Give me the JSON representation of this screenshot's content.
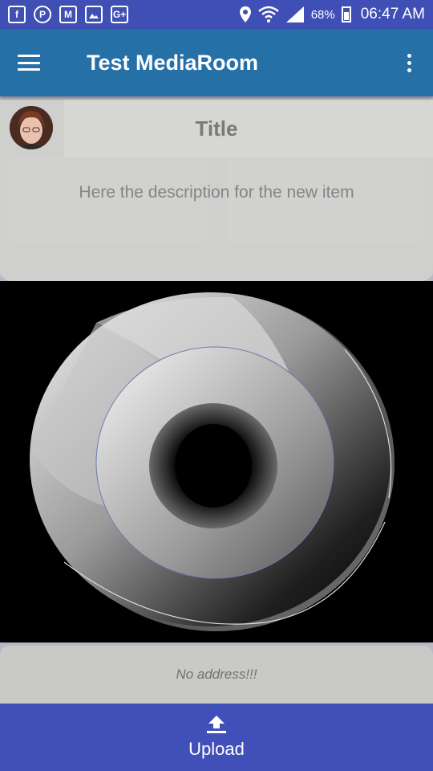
{
  "status_bar": {
    "notifications": [
      "facebook-icon",
      "pinterest-icon",
      "gmail-icon",
      "gallery-icon",
      "google-plus-icon"
    ],
    "battery": "68%",
    "time": "06:47 AM"
  },
  "app_bar": {
    "title": "Test MediaRoom"
  },
  "dialog": {
    "title": "Title",
    "description": "Here the description for the new item"
  },
  "address": {
    "text": "No address!!!"
  },
  "upload": {
    "label": "Upload"
  },
  "colors": {
    "status_bar": "#3f4fb5",
    "app_bar": "#2670a8",
    "upload_bar": "#4050b8"
  }
}
